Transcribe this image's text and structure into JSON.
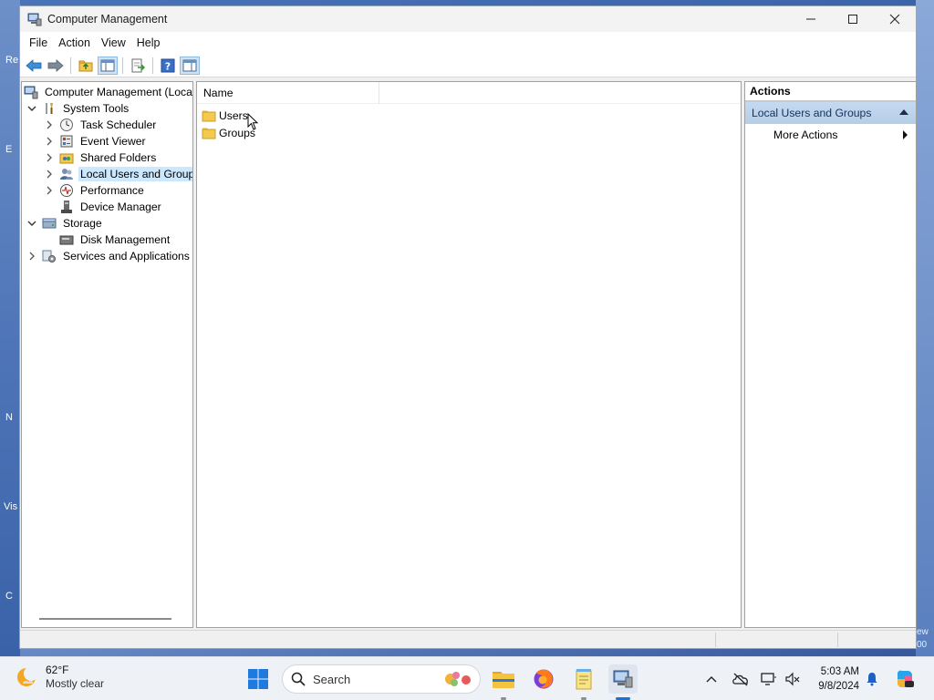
{
  "window": {
    "title": "Computer Management",
    "controls": {
      "minimize": "—",
      "maximize": "☐",
      "close": "✕"
    }
  },
  "menu": [
    "File",
    "Action",
    "View",
    "Help"
  ],
  "tree": {
    "root": "Computer Management (Local",
    "items": [
      {
        "label": "System Tools",
        "icon": "tools-icon"
      },
      {
        "label": "Task Scheduler",
        "icon": "clock-icon"
      },
      {
        "label": "Event Viewer",
        "icon": "event-viewer-icon"
      },
      {
        "label": "Shared Folders",
        "icon": "shared-folder-icon"
      },
      {
        "label": "Local Users and Groups",
        "icon": "users-icon"
      },
      {
        "label": "Performance",
        "icon": "performance-icon"
      },
      {
        "label": "Device Manager",
        "icon": "device-manager-icon"
      },
      {
        "label": "Storage",
        "icon": "storage-icon"
      },
      {
        "label": "Disk Management",
        "icon": "disk-icon"
      },
      {
        "label": "Services and Applications",
        "icon": "services-icon"
      }
    ]
  },
  "list": {
    "column": "Name",
    "rows": [
      "Users",
      "Groups"
    ]
  },
  "actions": {
    "header": "Actions",
    "group": "Local Users and Groups",
    "items": [
      "More Actions"
    ]
  },
  "taskbar": {
    "weather_temp": "62°F",
    "weather_desc": "Mostly clear",
    "search_placeholder": "Search",
    "time": "5:03 AM",
    "date": "9/8/2024"
  },
  "desktop": {
    "fragments": [
      "Re",
      "E",
      "N",
      "Vis",
      "C"
    ],
    "right_fragments": [
      "ew",
      "00"
    ]
  },
  "colors": {
    "selection": "#cce8ff",
    "actions_group_bg": "#c5daf0",
    "folder": "#f3c94e"
  }
}
